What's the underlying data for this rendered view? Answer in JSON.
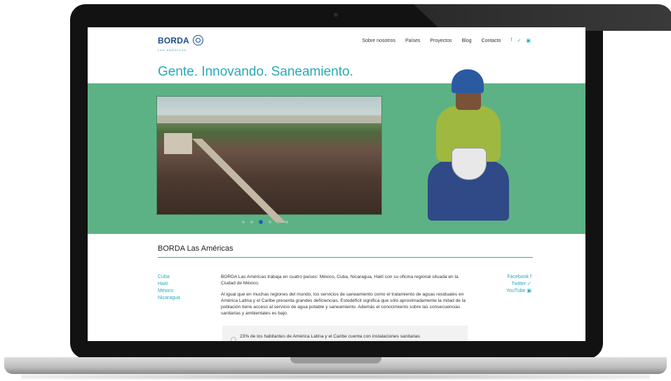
{
  "logo": {
    "name": "BORDA",
    "sub": "LAS AMÉRICAS"
  },
  "nav": {
    "items": [
      "Sobre nosotros",
      "Países",
      "Proyectos",
      "Blog",
      "Contacto"
    ],
    "social": [
      "f",
      "✓",
      "▣"
    ]
  },
  "hero": {
    "tagline": "Gente. Innovando. Saneamiento.",
    "slides": 6,
    "active_slide": 3
  },
  "section": {
    "title": "BORDA Las Américas"
  },
  "countries": [
    "Cuba",
    "Haití",
    "México",
    "Nicaragua"
  ],
  "body": {
    "p1": "BORDA Las Américas trabaja en cuatro países: México, Cuba, Nicaragua, Haití con su oficina regional situada en la Ciudad de México.",
    "p2": "Al igual que en muchas regiones del mundo, los servicios de saneamiento como el tratamiento de aguas residuales en América Latina y el Caribe presenta grandes deficiencias. Estedéficit significa que sólo aproximadamente la mitad de la población tiene acceso al servicio de agua potable y saneamiento. Además el conocimiento sobre las consecuencias sanitarias y ambientales es bajo."
  },
  "social_links": [
    "Facebook",
    "Twitter",
    "YouTube"
  ],
  "quote": "23% de los habitantes de América Latina y el Caribe cuenta con instalaciones sanitarias"
}
